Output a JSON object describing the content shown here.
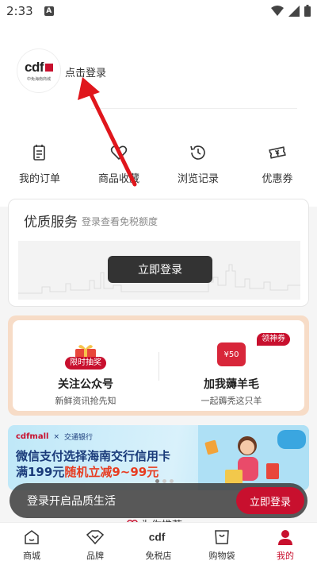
{
  "status_bar": {
    "time": "2:33",
    "notification_badge": "A"
  },
  "profile": {
    "avatar_logo": "cdf",
    "avatar_sub": "中免海南商城",
    "login_text": "点击登录"
  },
  "quick_links": [
    {
      "label": "我的订单",
      "icon": "order-icon"
    },
    {
      "label": "商品收藏",
      "icon": "favorite-icon"
    },
    {
      "label": "浏览记录",
      "icon": "history-icon"
    },
    {
      "label": "优惠券",
      "icon": "coupon-icon"
    }
  ],
  "service": {
    "title": "优质服务",
    "subtitle": "登录查看免税额度",
    "login_button": "立即登录"
  },
  "follow": {
    "left": {
      "badge": "限时抽奖",
      "title": "关注公众号",
      "subtitle": "新鲜资讯抢先知"
    },
    "right": {
      "badge": "领神券",
      "coupon_value": "¥50",
      "title": "加我薅羊毛",
      "subtitle": "一起薅秃这只羊"
    }
  },
  "banner": {
    "brand": "cdfmall",
    "brand_partner": "交通银行",
    "line1": "微信支付选择海南交行信用卡",
    "line2_prefix": "满199元",
    "line2_highlight": "随机立减9~99元"
  },
  "float_bar": {
    "text": "登录开启品质生活",
    "button": "立即登录"
  },
  "peek_text": "为你推荐",
  "tabs": [
    {
      "label": "商城",
      "icon": "home-icon",
      "active": false
    },
    {
      "label": "品牌",
      "icon": "brand-icon",
      "active": false
    },
    {
      "label": "免税店",
      "icon": "cdf-logo-icon",
      "active": false
    },
    {
      "label": "购物袋",
      "icon": "bag-icon",
      "active": false
    },
    {
      "label": "我的",
      "icon": "user-icon",
      "active": true
    }
  ],
  "colors": {
    "accent": "#c8102e",
    "banner_text": "#1a3b7a",
    "highlight": "#e83c20"
  }
}
